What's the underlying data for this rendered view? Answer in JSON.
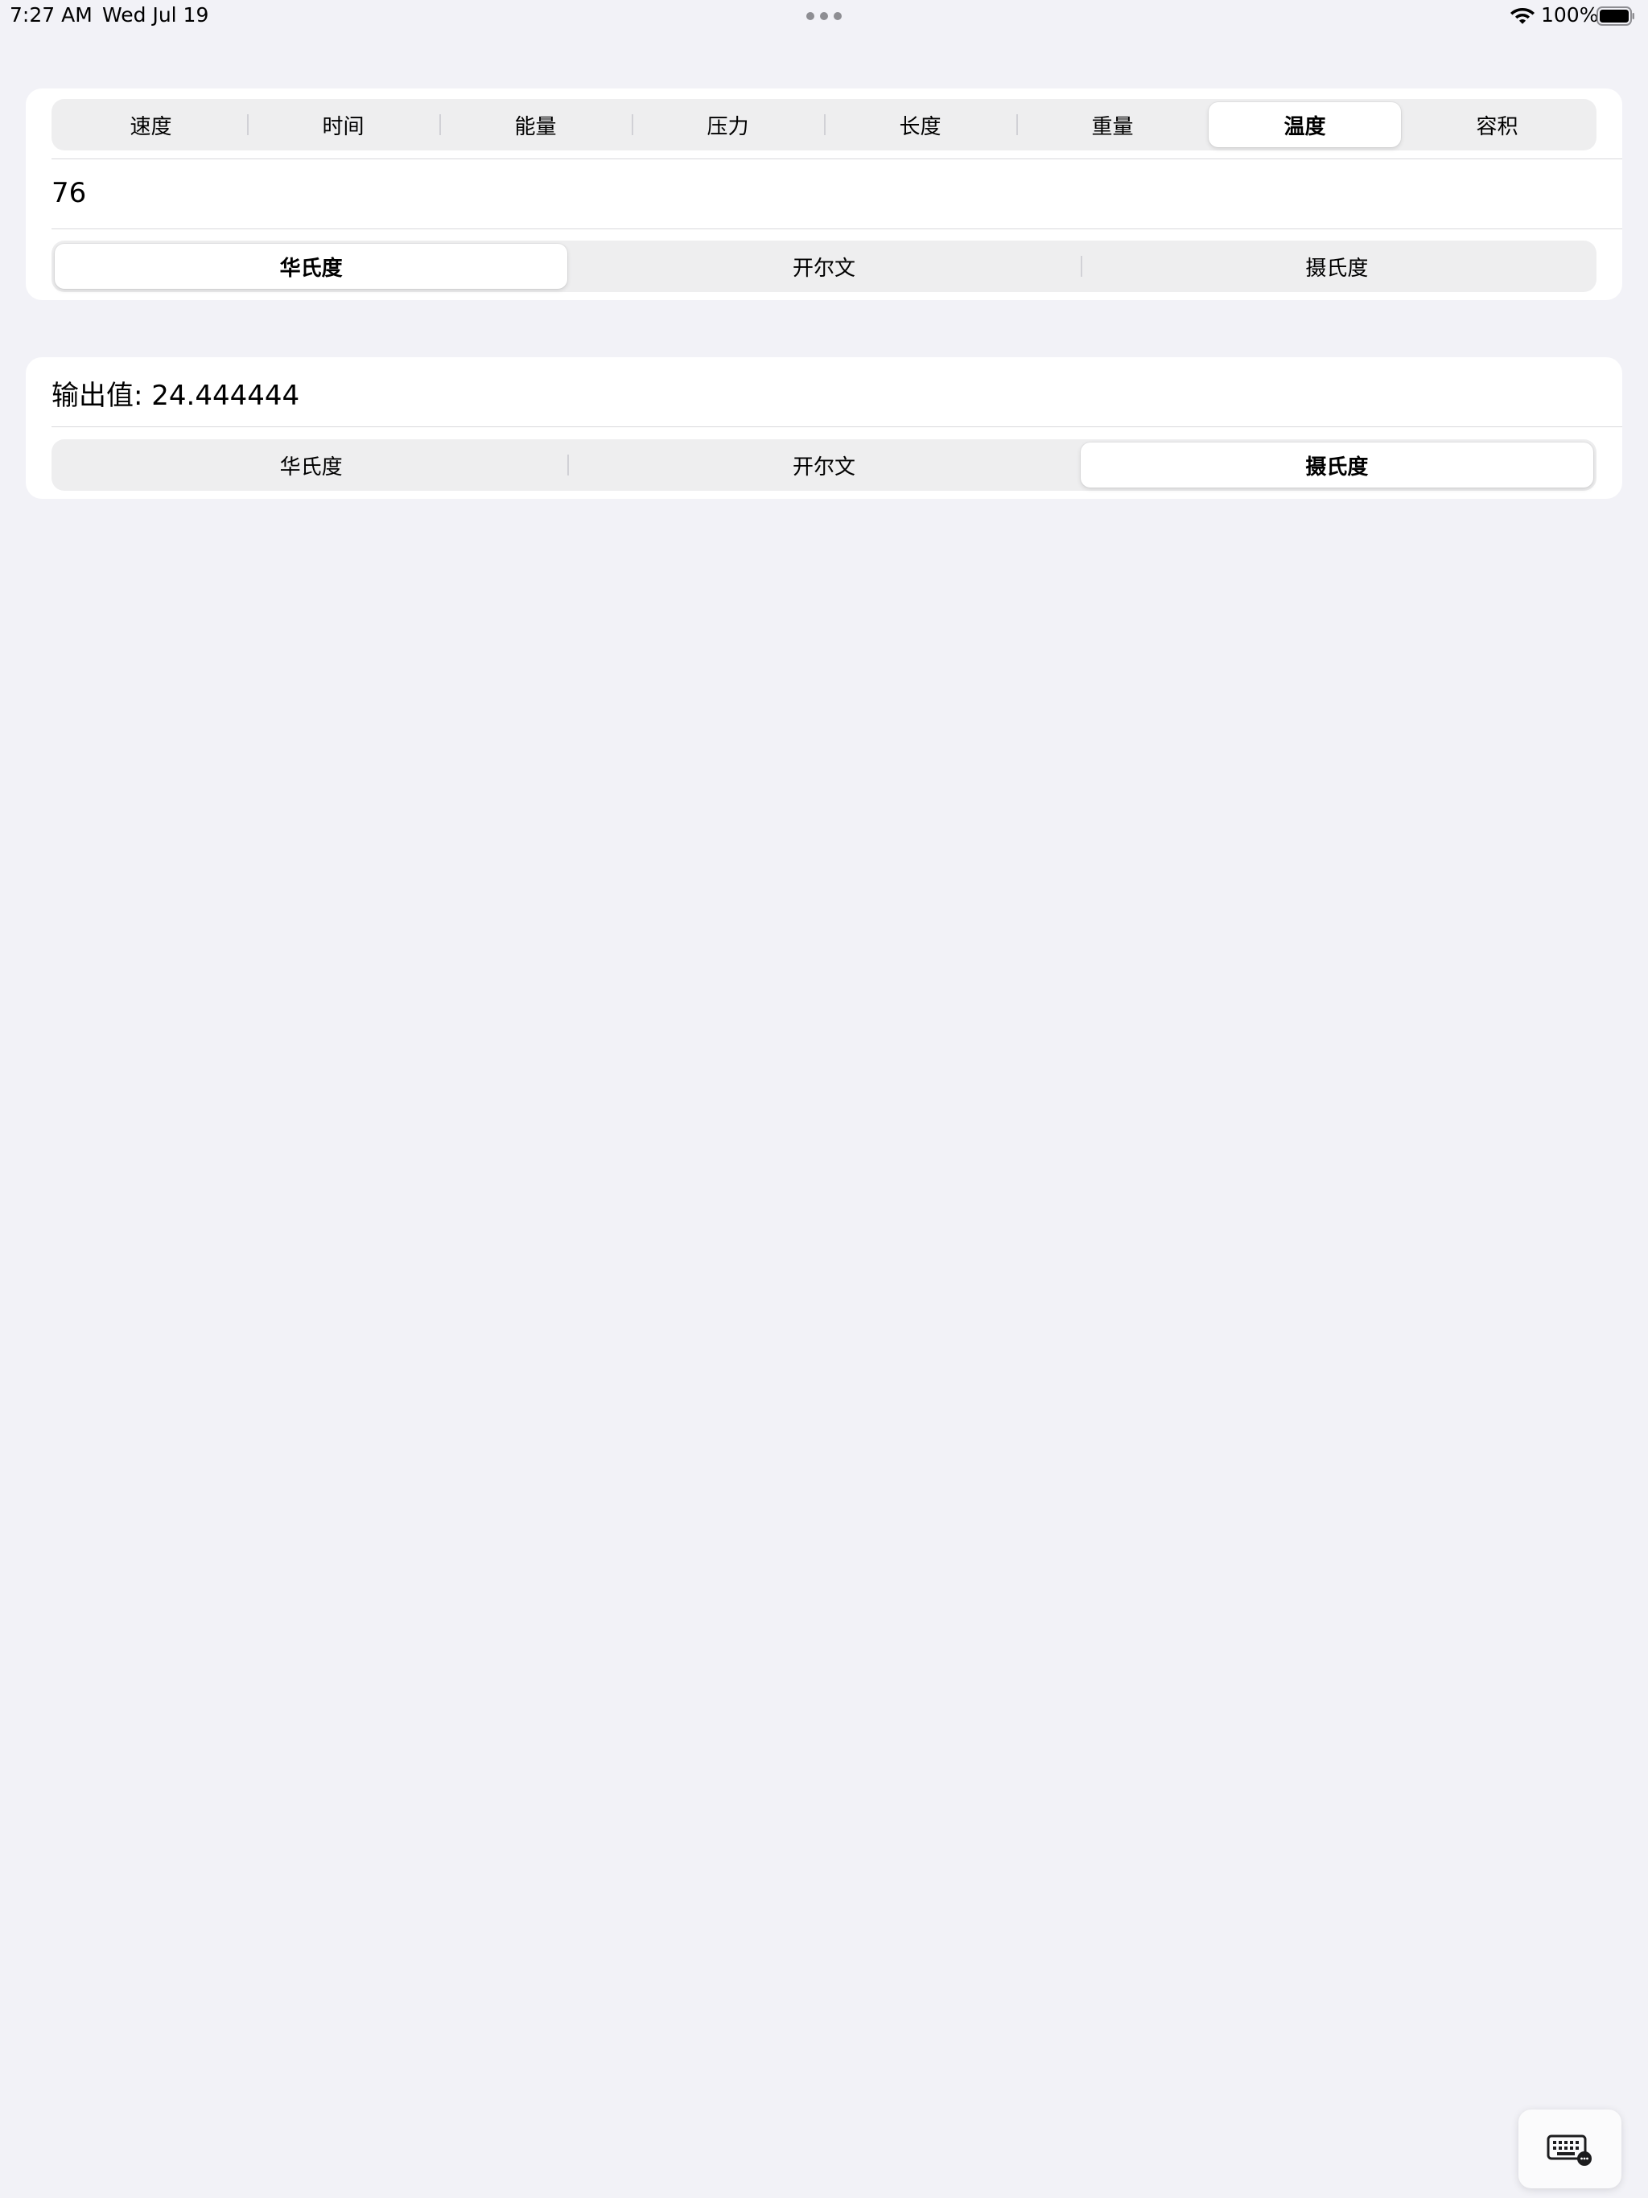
{
  "status_bar": {
    "time": "7:27 AM",
    "date": "Wed Jul 19",
    "battery_percent": "100%",
    "battery_level": 1.0
  },
  "category_tabs": [
    {
      "label": "速度",
      "selected": false
    },
    {
      "label": "时间",
      "selected": false
    },
    {
      "label": "能量",
      "selected": false
    },
    {
      "label": "压力",
      "selected": false
    },
    {
      "label": "长度",
      "selected": false
    },
    {
      "label": "重量",
      "selected": false
    },
    {
      "label": "温度",
      "selected": true
    },
    {
      "label": "容积",
      "selected": false
    }
  ],
  "input": {
    "value": "76"
  },
  "input_units": [
    {
      "label": "华氏度",
      "selected": true
    },
    {
      "label": "开尔文",
      "selected": false
    },
    {
      "label": "摄氏度",
      "selected": false
    }
  ],
  "output": {
    "label": "输出值: 24.444444"
  },
  "output_units": [
    {
      "label": "华氏度",
      "selected": false
    },
    {
      "label": "开尔文",
      "selected": false
    },
    {
      "label": "摄氏度",
      "selected": true
    }
  ],
  "icons": {
    "multitask": "ellipsis-icon",
    "wifi": "wifi-icon",
    "battery": "battery-icon",
    "keyboard": "keyboard-icon"
  },
  "colors": {
    "background": "#f2f2f7",
    "card": "#ffffff",
    "segment_track": "#eeeeef",
    "segment_selected": "#ffffff"
  }
}
